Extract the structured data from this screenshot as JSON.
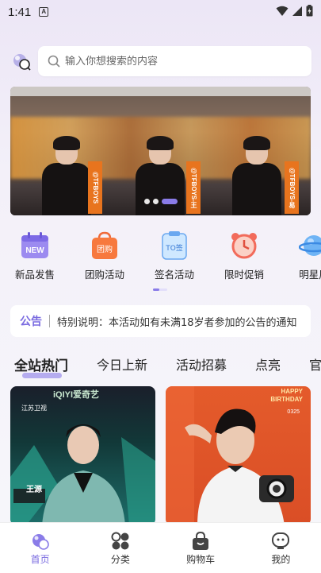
{
  "status_bar": {
    "time": "1:41",
    "notification_letter": "A"
  },
  "search": {
    "placeholder": "输入你想搜索的内容"
  },
  "banner": {
    "tags": [
      "@TFBOYS",
      "@TFBOYS-王",
      "@TFBOYS-易"
    ],
    "slide_count": 3,
    "active_slide": 3
  },
  "categories": [
    {
      "label": "新品发售",
      "icon": "new-calendar-icon",
      "icon_text": "NEW"
    },
    {
      "label": "团购活动",
      "icon": "group-buy-bag-icon",
      "icon_text": "团购"
    },
    {
      "label": "签名活动",
      "icon": "signature-board-icon",
      "icon_text": "TO签"
    },
    {
      "label": "限时促销",
      "icon": "alarm-clock-icon"
    },
    {
      "label": "明星周",
      "icon": "planet-icon"
    }
  ],
  "notice": {
    "label": "公告",
    "text": "特别说明：本活动如有未满18岁者参加的公告的通知"
  },
  "tabs": [
    {
      "label": "全站热门",
      "active": true
    },
    {
      "label": "今日上新",
      "active": false
    },
    {
      "label": "活动招募",
      "active": false
    },
    {
      "label": "点亮",
      "active": false
    },
    {
      "label": "官",
      "active": false
    }
  ],
  "cards": [
    {
      "captions": [
        "iQIYI爱奇艺",
        "江苏卫视",
        "王源"
      ]
    },
    {
      "captions": [
        "HAPPY",
        "BIRTHDAY",
        "0325"
      ]
    }
  ],
  "bottom_nav": [
    {
      "label": "首页",
      "icon": "home-planet-icon",
      "active": true
    },
    {
      "label": "分类",
      "icon": "category-grid-icon",
      "active": false
    },
    {
      "label": "购物车",
      "icon": "shopping-bag-icon",
      "active": false
    },
    {
      "label": "我的",
      "icon": "profile-face-icon",
      "active": false
    }
  ],
  "colors": {
    "accent": "#8a7ce8",
    "notice_label": "#7a6be0",
    "orange_tag": "#e8741e"
  }
}
